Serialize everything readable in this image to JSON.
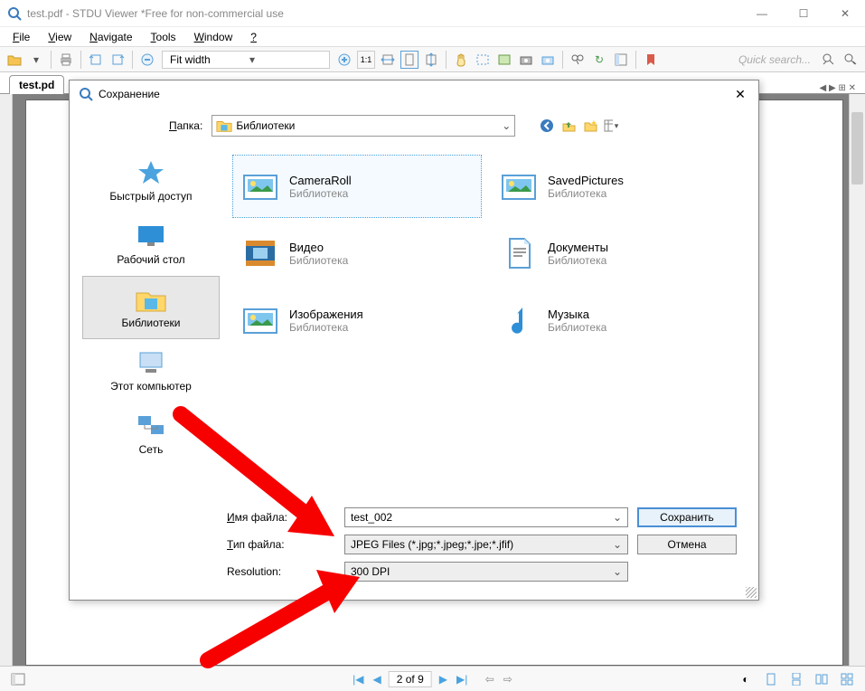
{
  "window": {
    "title": "test.pdf - STDU Viewer *Free for non-commercial use"
  },
  "menus": [
    "File",
    "View",
    "Navigate",
    "Tools",
    "Window",
    "?"
  ],
  "toolbar": {
    "zoom_mode": "Fit width",
    "page_hint": "1:1",
    "quick_search_placeholder": "Quick search..."
  },
  "tab": {
    "label": "test.pd"
  },
  "tabbar_right": "◀ ▶ ⊞ ✕",
  "statusbar": {
    "page_text": "2 of 9"
  },
  "dialog": {
    "title": "Сохранение",
    "folder_label": "Папка:",
    "folder_value": "Библиотеки",
    "places": [
      {
        "label": "Быстрый доступ",
        "icon": "star"
      },
      {
        "label": "Рабочий стол",
        "icon": "desktop"
      },
      {
        "label": "Библиотеки",
        "icon": "libraries",
        "selected": true
      },
      {
        "label": "Этот компьютер",
        "icon": "pc"
      },
      {
        "label": "Сеть",
        "icon": "network"
      }
    ],
    "files": [
      {
        "name": "CameraRoll",
        "sub": "Библиотека",
        "icon": "pic",
        "selected": true
      },
      {
        "name": "SavedPictures",
        "sub": "Библиотека",
        "icon": "pic"
      },
      {
        "name": "Видео",
        "sub": "Библиотека",
        "icon": "video"
      },
      {
        "name": "Документы",
        "sub": "Библиотека",
        "icon": "doc"
      },
      {
        "name": "Изображения",
        "sub": "Библиотека",
        "icon": "pic"
      },
      {
        "name": "Музыка",
        "sub": "Библиотека",
        "icon": "music"
      }
    ],
    "filename_label": "Имя файла:",
    "filename_value": "test_002",
    "filetype_label": "Тип файла:",
    "filetype_value": "JPEG Files (*.jpg;*.jpeg;*.jpe;*.jfif)",
    "resolution_label": "Resolution:",
    "resolution_value": "300 DPI",
    "save_btn": "Сохранить",
    "cancel_btn": "Отмена"
  }
}
